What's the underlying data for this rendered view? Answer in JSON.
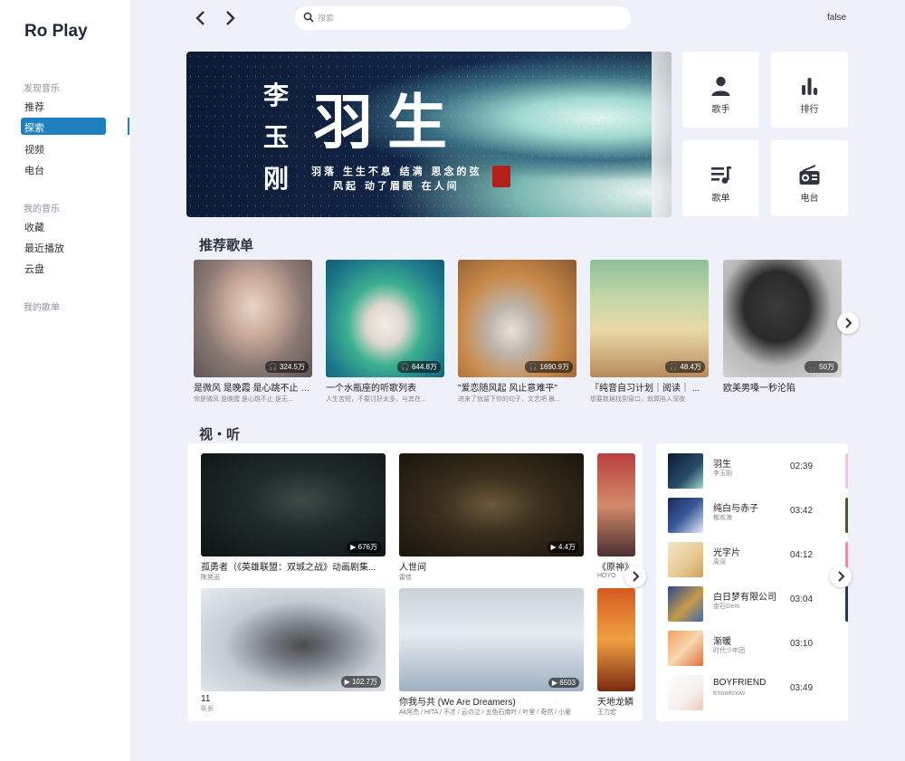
{
  "app": {
    "name": "Ro Play"
  },
  "sidebar": {
    "discover_title": "发现音乐",
    "discover_items": [
      {
        "label": "推荐",
        "active": false
      },
      {
        "label": "探索",
        "active": true
      },
      {
        "label": "视频",
        "active": false
      },
      {
        "label": "电台",
        "active": false
      }
    ],
    "my_music_title": "我的音乐",
    "my_music_items": [
      {
        "label": "收藏"
      },
      {
        "label": "最近播放"
      },
      {
        "label": "云盘"
      }
    ],
    "my_playlists_title": "我的歌单"
  },
  "topbar": {
    "back_icon": "chevron-left-icon",
    "forward_icon": "chevron-right-icon",
    "search_placeholder": "搜索",
    "search_value": "",
    "right_text": "false"
  },
  "banner": {
    "artist": "李玉刚",
    "title": "羽生",
    "line1": "羽落 生生不息 结满 思念的弦",
    "line2": "风起 动了眉眼 在人间"
  },
  "quick_tiles": [
    {
      "label": "歌手",
      "icon": "person-icon"
    },
    {
      "label": "排行",
      "icon": "bar-chart-icon"
    },
    {
      "label": "歌单",
      "icon": "playlist-icon"
    },
    {
      "label": "电台",
      "icon": "radio-icon"
    }
  ],
  "recommended": {
    "title": "推荐歌单",
    "playlists": [
      {
        "name": "是微风 是晚霞 是心跳不止 是无...",
        "desc": "你是微风 是晚霞 是心跳不止 是无...",
        "plays": "324.5万"
      },
      {
        "name": "一个水瓶座的听歌列表",
        "desc": "人生苦短，不要讨好太多，与其在...",
        "plays": "644.8万"
      },
      {
        "name": "\"爱恋随风起 风止意难平\"",
        "desc": "进来了就留下你的句子，文艺吧 晨...",
        "plays": "1690.9万"
      },
      {
        "name": "『纯音自习计划｜阅读｜ ...",
        "desc": "想要数据找到窗口，就算陷入深夜",
        "plays": "48.4万"
      },
      {
        "name": "欧美男嗓一秒沦陷",
        "desc": "",
        "plays": "50万"
      }
    ]
  },
  "videos": {
    "title": "视・听",
    "items": [
      {
        "title": "孤勇者（《英雄联盟：双城之战》动画剧集...",
        "author": "陈奕迅",
        "views": "676万"
      },
      {
        "title": "人世间",
        "author": "雷佳",
        "views": "4.4万"
      },
      {
        "title": "《原神》",
        "author": "HOYO",
        "views": ""
      },
      {
        "title": "11",
        "author": "队长",
        "views": "102.7万"
      },
      {
        "title": "你我与共 (We Are Dreamers)",
        "author": "Ak阿杰 / HITA / 不才 / 云の泣 / 五色石南叶 / 叶里 / 奇然 / 小爱",
        "views": "6503"
      },
      {
        "title": "天地龙鳞",
        "author": "王力宏",
        "views": ""
      }
    ]
  },
  "songs": [
    {
      "name": "羽生",
      "artist": "李玉刚",
      "duration": "02:39"
    },
    {
      "name": "纯白与赤子",
      "artist": "郁欢海",
      "duration": "03:42"
    },
    {
      "name": "光字片",
      "artist": "周深",
      "duration": "04:12"
    },
    {
      "name": "白日梦有限公司",
      "artist": "金石Gem",
      "duration": "03:04"
    },
    {
      "name": "渐暖",
      "artist": "时代少年团",
      "duration": "03:10"
    },
    {
      "name": "BOYFRIEND",
      "artist": "KnowKnow",
      "duration": "03:49"
    }
  ],
  "colors": {
    "accent": "#1f7fbf",
    "page_bg": "#eef1fa",
    "sidebar_bg": "#ffffff"
  }
}
